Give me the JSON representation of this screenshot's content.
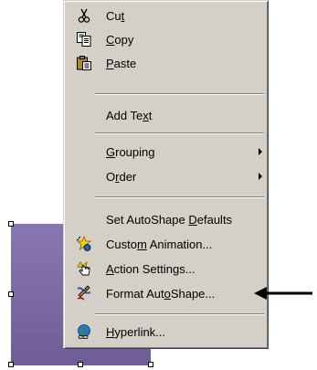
{
  "menu": {
    "items": [
      {
        "id": "cut",
        "before": "Cu",
        "accel": "t",
        "after": "",
        "icon": "scissors-icon"
      },
      {
        "id": "copy",
        "before": "",
        "accel": "C",
        "after": "opy",
        "icon": "copy-icon"
      },
      {
        "id": "paste",
        "before": "",
        "accel": "P",
        "after": "aste",
        "icon": "paste-icon"
      },
      {
        "id": "add-text",
        "before": "Add Te",
        "accel": "x",
        "after": "t",
        "icon": ""
      },
      {
        "id": "grouping",
        "before": "",
        "accel": "G",
        "after": "rouping",
        "icon": "",
        "submenu": true
      },
      {
        "id": "order",
        "before": "O",
        "accel": "r",
        "after": "der",
        "icon": "",
        "submenu": true
      },
      {
        "id": "set-defaults",
        "before": "Set AutoShape ",
        "accel": "D",
        "after": "efaults",
        "icon": ""
      },
      {
        "id": "custom-animation",
        "before": "Custo",
        "accel": "m",
        "after": " Animation...",
        "icon": "animation-icon"
      },
      {
        "id": "action-settings",
        "before": "",
        "accel": "A",
        "after": "ction Settings...",
        "icon": "action-hand-icon"
      },
      {
        "id": "format-autoshape",
        "before": "Format Aut",
        "accel": "o",
        "after": "Shape...",
        "icon": "format-brush-icon"
      },
      {
        "id": "hyperlink",
        "before": "",
        "accel": "H",
        "after": "yperlink...",
        "icon": "hyperlink-globe-icon"
      }
    ]
  },
  "colors": {
    "menu_bg": "#d4d0c8",
    "shape_fill": "#7d6aa6"
  }
}
